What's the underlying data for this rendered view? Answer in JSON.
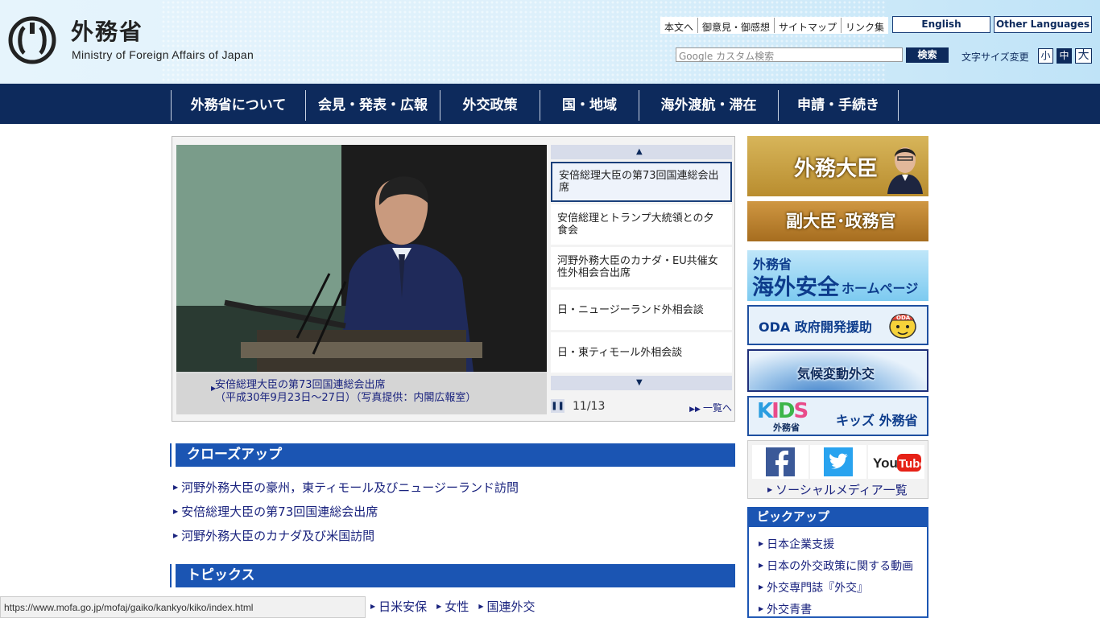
{
  "header": {
    "logo_ja": "外務省",
    "logo_en": "Ministry of Foreign Affairs of Japan",
    "util_links": [
      "本文へ",
      "御意見・御感想",
      "サイトマップ",
      "リンク集"
    ],
    "lang_english": "English",
    "lang_other": "Other Languages",
    "search_placeholder": "Google カスタム検索",
    "search_button": "検索",
    "fontsize_label": "文字サイズ変更",
    "fontsize_small": "小",
    "fontsize_mid": "中",
    "fontsize_large": "大"
  },
  "nav": {
    "items": [
      "外務省について",
      "会見・発表・広報",
      "外交政策",
      "国・地域",
      "海外渡航・滞在",
      "申請・手続き"
    ]
  },
  "slideshow": {
    "caption_line1": "安倍総理大臣の第73回国連総会出席",
    "caption_line2": "（平成30年9月23日～27日）（写真提供：内閣広報室）",
    "items": [
      "安倍総理大臣の第73回国連総会出席",
      "安倍総理とトランプ大統領との夕食会",
      "河野外務大臣のカナダ・EU共催女性外相会合出席",
      "日・ニュージーランド外相会談",
      "日・東ティモール外相会談"
    ],
    "counter": "11/13",
    "more_link": "一覧へ"
  },
  "closeup": {
    "title": "クローズアップ",
    "links": [
      "河野外務大臣の豪州，東ティモール及びニュージーランド訪問",
      "安倍総理大臣の第73回国連総会出席",
      "河野外務大臣のカナダ及び米国訪問"
    ]
  },
  "topics": {
    "title": "トピックス",
    "links": [
      "日米安保",
      "女性",
      "国連外交"
    ]
  },
  "status_url": "https://www.mofa.go.jp/mofaj/gaiko/kankyo/kiko/index.html",
  "banners": {
    "minister": "外務大臣",
    "vice": "副大臣･政務官",
    "safety_line1": "外務省",
    "safety_line2": "海外安全",
    "safety_line3": "ホームページ",
    "oda": "ODA 政府開発援助",
    "climate": "気候変動外交",
    "kids_logo": "KIDS",
    "kids_sub": "外務省",
    "kids": "キッズ 外務省"
  },
  "social": {
    "link": "ソーシャルメディア一覧"
  },
  "pickup": {
    "title": "ピックアップ",
    "links": [
      "日本企業支援",
      "日本の外交政策に関する動画",
      "外交専門誌『外交』",
      "外交青書"
    ]
  },
  "colors": {
    "navy": "#0d2a5c",
    "section_blue": "#1b55b3",
    "link": "#1a237e"
  }
}
